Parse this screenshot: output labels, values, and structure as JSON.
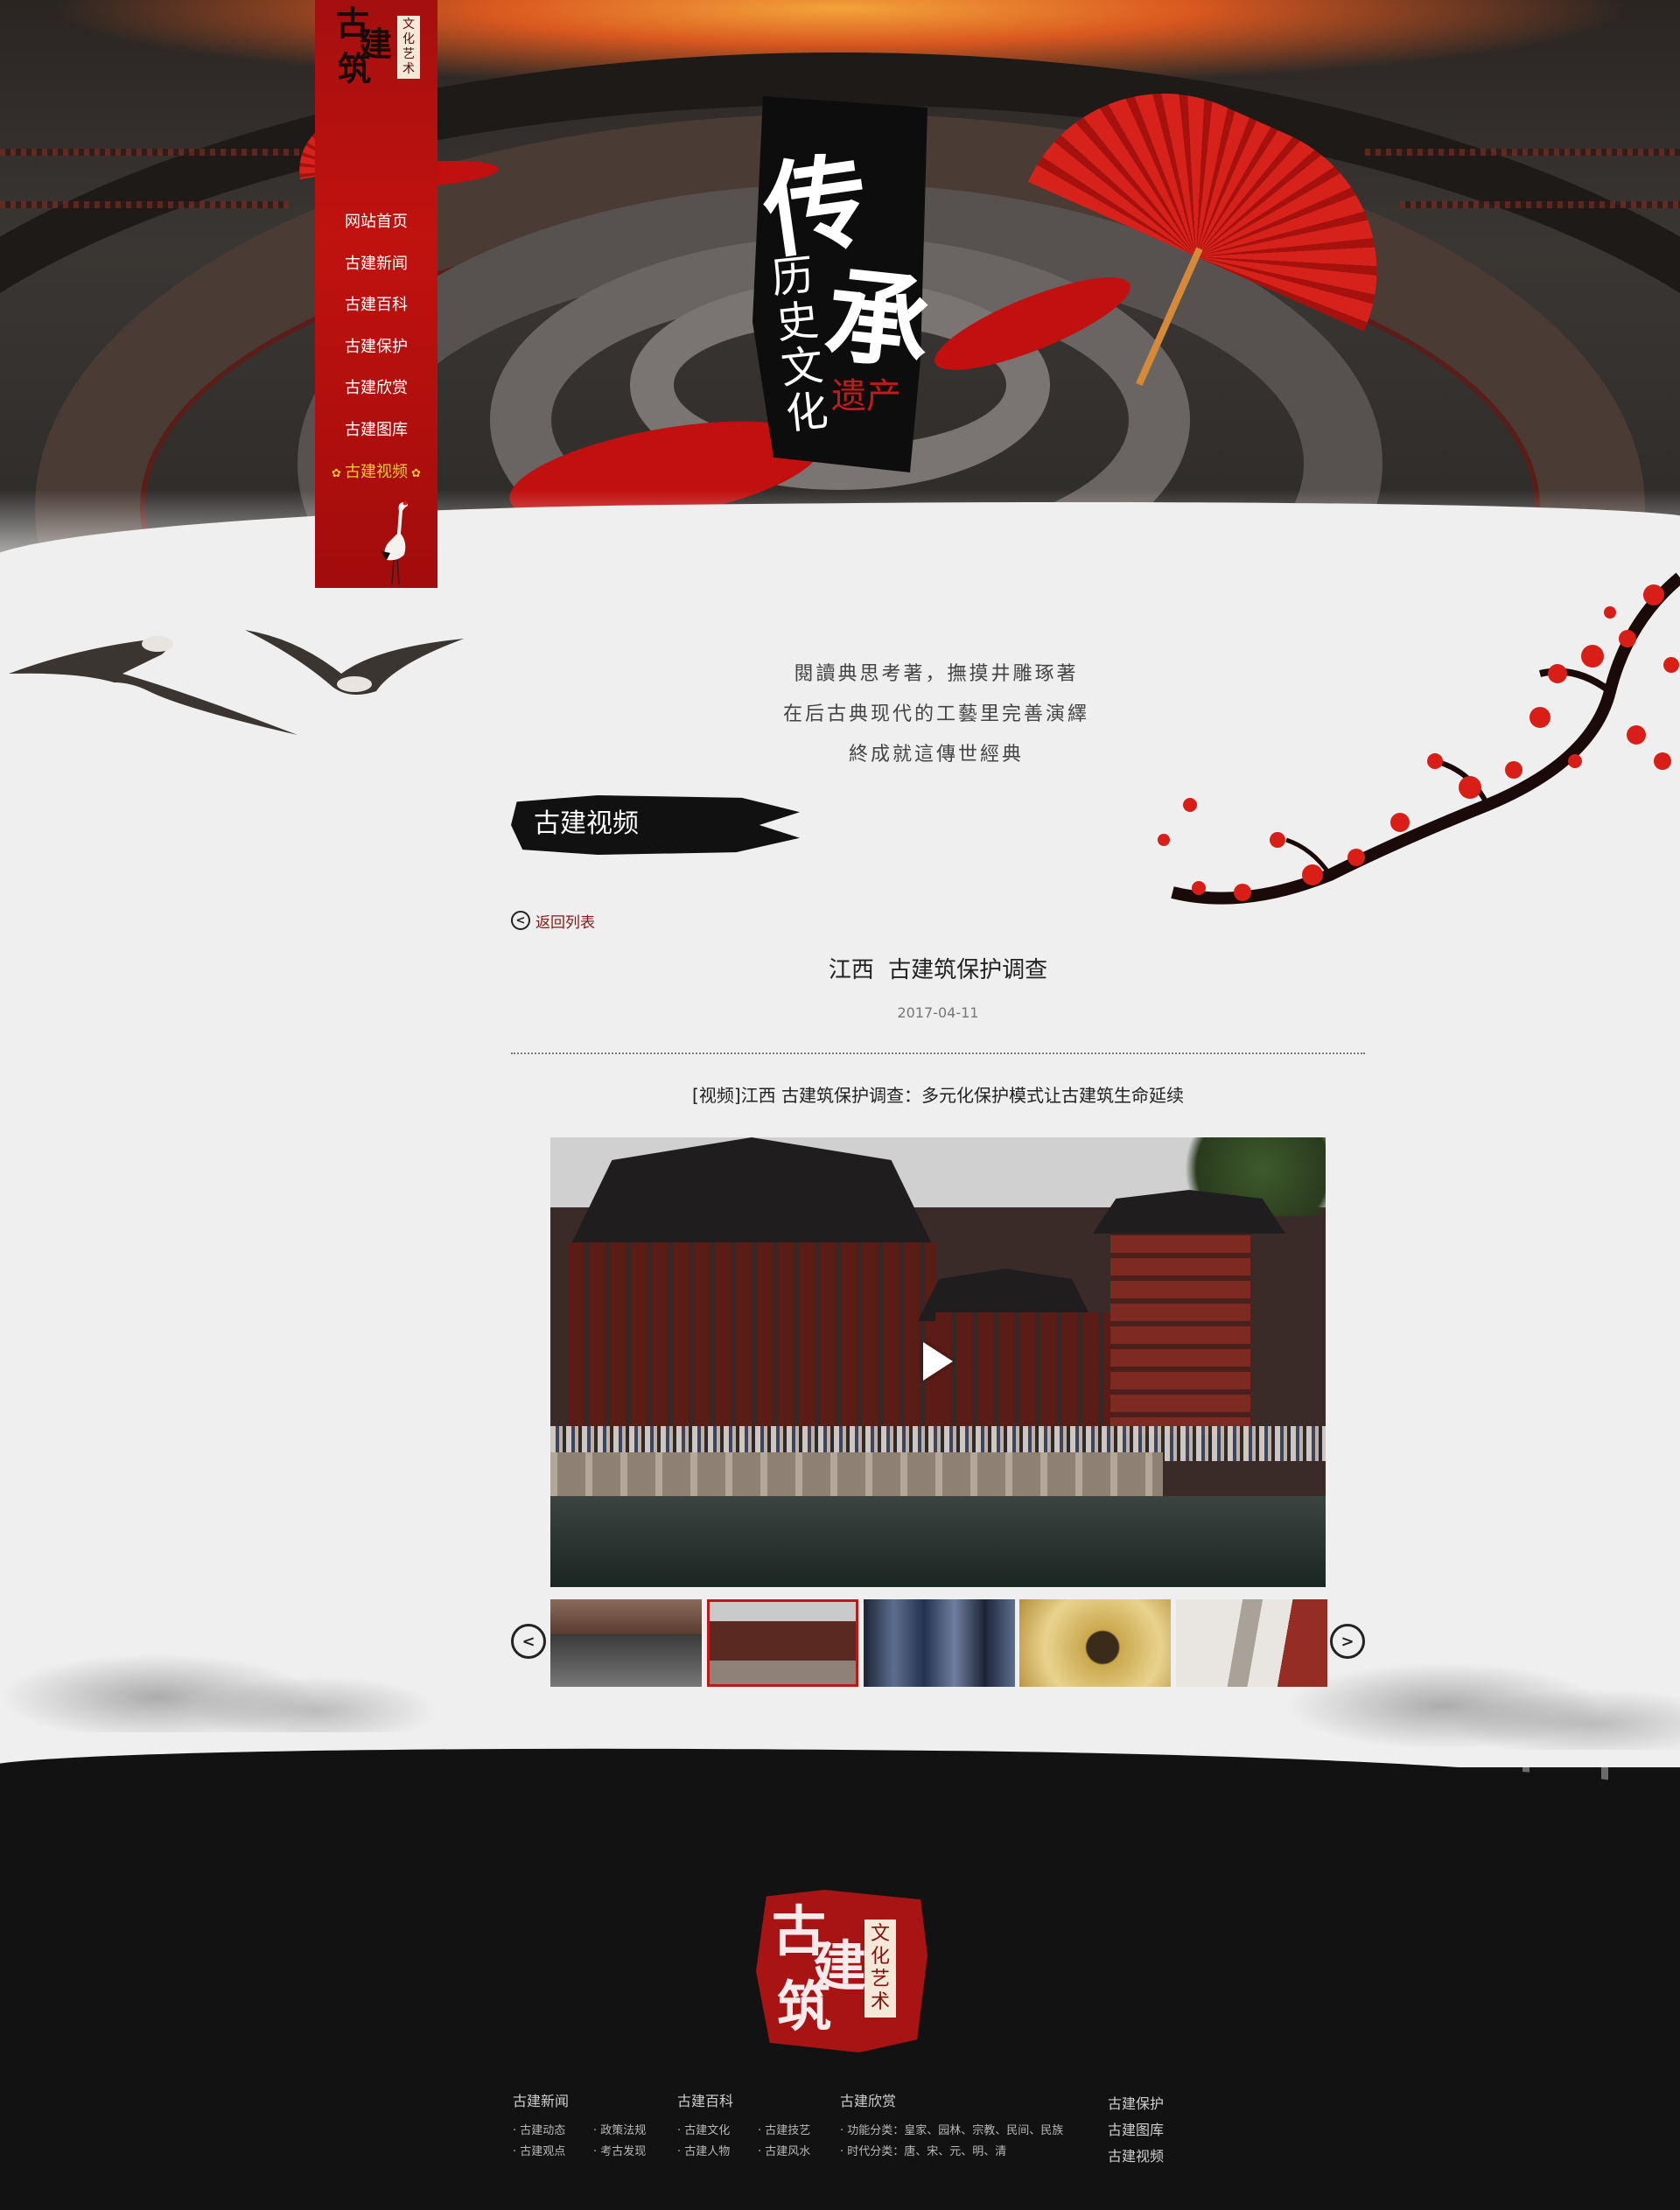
{
  "nav": {
    "logo": {
      "chars": [
        "古",
        "建",
        "筑"
      ],
      "tag": "文化艺术"
    },
    "items": [
      {
        "label": "网站首页",
        "active": false
      },
      {
        "label": "古建新闻",
        "active": false
      },
      {
        "label": "古建百科",
        "active": false
      },
      {
        "label": "古建保护",
        "active": false
      },
      {
        "label": "古建欣赏",
        "active": false
      },
      {
        "label": "古建图库",
        "active": false
      },
      {
        "label": "古建视频",
        "active": true
      }
    ]
  },
  "hero": {
    "calligraphy_big_1": "传",
    "calligraphy_big_2": "承",
    "calligraphy_small": "历史文化",
    "calligraphy_red": "遗产"
  },
  "tagline": [
    "閱讀典思考著，撫摸井雕琢著",
    "在后古典现代的工藝里完善演繹",
    "終成就這傳世經典"
  ],
  "section": {
    "title": "古建视频"
  },
  "back_link": {
    "label": "返回列表"
  },
  "article": {
    "title": "江西 古建筑保护调查",
    "date": "2017-04-11",
    "description": "[视频]江西 古建筑保护调查：多元化保护模式让古建筑生命延续"
  },
  "video": {
    "play_icon": "play-icon"
  },
  "thumbnails": {
    "active_index": 1,
    "count": 5,
    "prev_icon": "prev-arrow-icon",
    "next_icon": "next-arrow-icon"
  },
  "footer": {
    "logo": {
      "chars": [
        "古",
        "建",
        "筑"
      ],
      "tag": "文化艺术"
    },
    "columns": [
      {
        "heading": "古建新闻",
        "items": [
          "古建动态",
          "政策法规",
          "古建观点",
          "考古发现"
        ]
      },
      {
        "heading": "古建百科",
        "items": [
          "古建文化",
          "古建技艺",
          "古建人物",
          "古建风水"
        ]
      },
      {
        "heading": "古建欣赏",
        "items": [
          "功能分类：皇家、园林、宗教、民间、民族",
          "时代分类：唐、宋、元、明、清"
        ]
      }
    ],
    "side_links": [
      "古建保护",
      "古建图库",
      "古建视频"
    ]
  },
  "colors": {
    "nav_red": "#b3110f",
    "active_gold": "#f3c53d",
    "back_link": "#8b1616",
    "footer_bg": "#121212",
    "page_bg": "#efefef"
  }
}
